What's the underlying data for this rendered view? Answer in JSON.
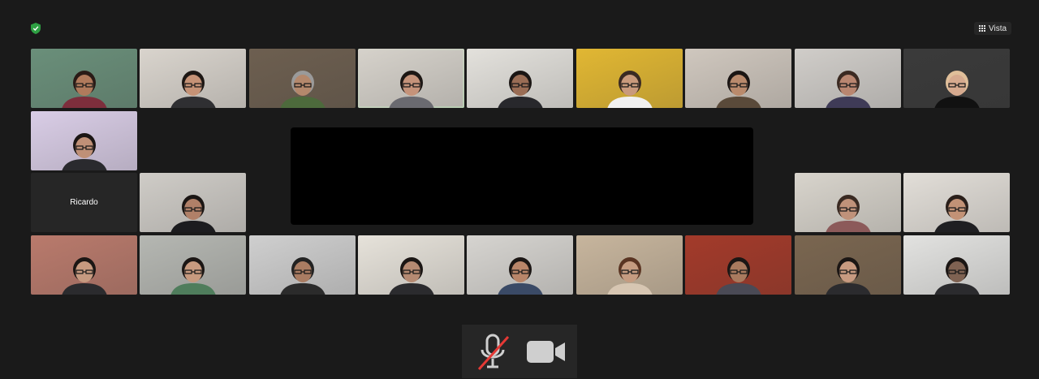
{
  "view_button": {
    "label": "Vista",
    "icon": "grid-icon"
  },
  "security_icon": {
    "icon": "shield-check-icon",
    "color": "#2ea043"
  },
  "participants": [
    {
      "name": "",
      "bg": "#6a8f7a",
      "skin": "#b07a5c",
      "hair": "#2a1b17",
      "shirt": "#7d2e3c"
    },
    {
      "name": "",
      "bg": "#d9d4cd",
      "skin": "#c59276",
      "hair": "#1d1714",
      "shirt": "#2f2f32"
    },
    {
      "name": "",
      "bg": "#6d5f50",
      "skin": "#b4886c",
      "hair": "#9a9a9a",
      "shirt": "#4d6a3c"
    },
    {
      "name": "",
      "bg": "#d6d2cb",
      "skin": "#c5937a",
      "hair": "#1d1714",
      "shirt": "#6a6a70",
      "active": true
    },
    {
      "name": "",
      "bg": "#e3e1dc",
      "skin": "#9a6d55",
      "hair": "#1b1614",
      "shirt": "#28282c"
    },
    {
      "name": "",
      "bg": "#e1b733",
      "skin": "#c99a7c",
      "hair": "#3a2a22",
      "shirt": "#f1f1f1"
    },
    {
      "name": "",
      "bg": "#cfc7be",
      "skin": "#b98a6c",
      "hair": "#1b1614",
      "shirt": "#5a4a3a"
    },
    {
      "name": "",
      "bg": "#d0cdc9",
      "skin": "#b98670",
      "hair": "#3b2a22",
      "shirt": "#3f3b57"
    },
    {
      "name": "",
      "bg": "#3a3a3a",
      "skin": "#d6aa8f",
      "hair": "#e0bf9a",
      "shirt": "#111111"
    },
    {
      "name": "",
      "bg": "#d9cde6",
      "skin": "#bf9077",
      "hair": "#1b1614",
      "shirt": "#2a2a2e"
    },
    {
      "name": "Ricardo",
      "name_only": true
    },
    {
      "name": "",
      "bg": "#cfccc7",
      "skin": "#b08068",
      "hair": "#1b1614",
      "shirt": "#1c1c1f"
    },
    {
      "name": "",
      "bg": "#d8d4cc",
      "skin": "#c0927a",
      "hair": "#3a2a22",
      "shirt": "#8c5a5a"
    },
    {
      "name": "",
      "bg": "#e2ded8",
      "skin": "#c29276",
      "hair": "#2a1f1a",
      "shirt": "#1f1f22"
    },
    {
      "name": "",
      "bg": "#b97a6c",
      "skin": "#c69a80",
      "hair": "#1b1614",
      "shirt": "#2b2b2e"
    },
    {
      "name": "",
      "bg": "#b5b7b2",
      "skin": "#c79a7f",
      "hair": "#1b1614",
      "shirt": "#4f7d5c"
    },
    {
      "name": "",
      "bg": "#cfcfcf",
      "skin": "#a97c62",
      "hair": "#222222",
      "shirt": "#2b2b2b"
    },
    {
      "name": "",
      "bg": "#e6e2da",
      "skin": "#b58a72",
      "hair": "#1b1614",
      "shirt": "#2b2b2e"
    },
    {
      "name": "",
      "bg": "#d6d4d0",
      "skin": "#b88569",
      "hair": "#1b1614",
      "shirt": "#3a4a66"
    },
    {
      "name": "",
      "bg": "#c7b59d",
      "skin": "#c59b80",
      "hair": "#5a3422",
      "shirt": "#d7c6b2"
    },
    {
      "name": "",
      "bg": "#a33a2a",
      "skin": "#a97a5e",
      "hair": "#1b1614",
      "shirt": "#4a4a55"
    },
    {
      "name": "",
      "bg": "#7a6650",
      "skin": "#c89a80",
      "hair": "#1b1614",
      "shirt": "#2b2b2e"
    },
    {
      "name": "",
      "bg": "#e2e2e0",
      "skin": "#7f6252",
      "hair": "#1b1614",
      "shirt": "#2b2b2e"
    }
  ],
  "toolbar": {
    "mic": {
      "icon": "microphone-muted-icon",
      "slash_color": "#e53935"
    },
    "camera": {
      "icon": "video-camera-icon"
    }
  }
}
